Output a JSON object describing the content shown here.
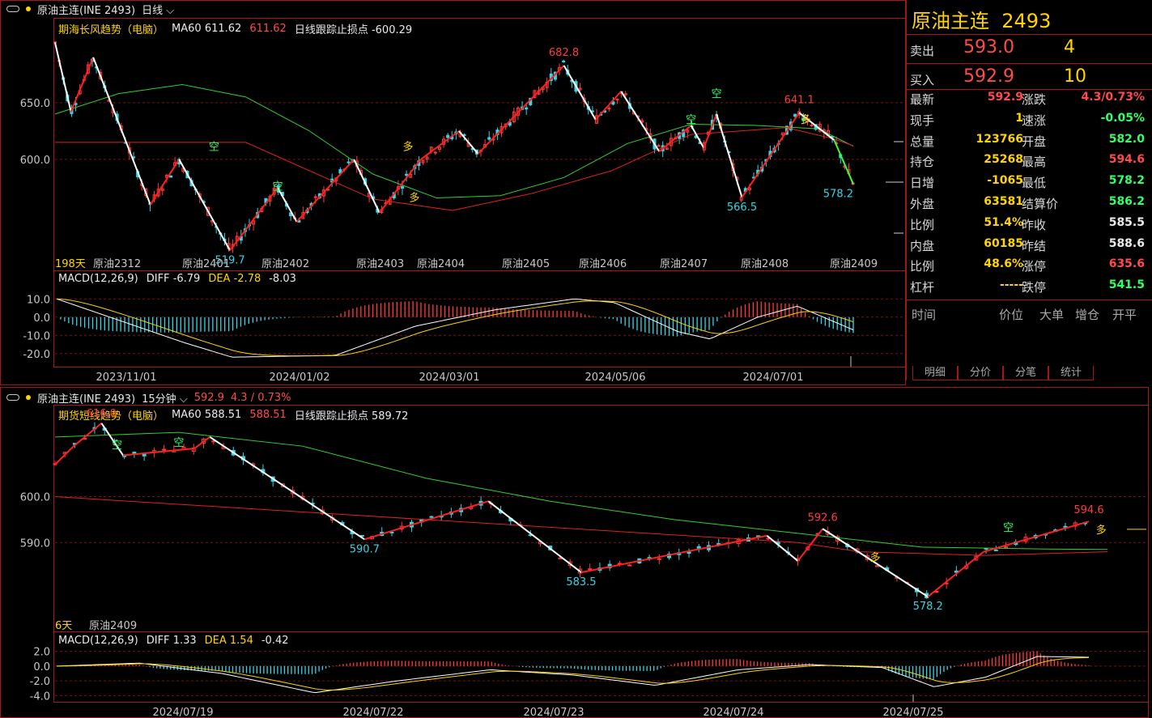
{
  "top_header": {
    "name": "原油主连(INE 2493)",
    "period": "日线"
  },
  "bottom_header": {
    "name": "原油主连(INE 2493)",
    "period": "15分钟",
    "price": "592.9",
    "change": "4.3 / 0.73%"
  },
  "top_legend": {
    "indicator": "期海长风趋势（电脑）",
    "ma_label": "MA60",
    "ma_value": "611.62",
    "ma_value2": "611.62",
    "stop_label": "日线跟踪止损点",
    "stop_value": "-600.29"
  },
  "bottom_legend": {
    "indicator": "期货短线趋势（电脑）",
    "ma_label": "MA60",
    "ma_value": "588.51",
    "ma_value2": "588.51",
    "stop_label": "日线跟踪止损点",
    "stop_value": "589.72"
  },
  "top_macd": {
    "label": "MACD(12,26,9)",
    "diff_label": "DIFF",
    "diff": "-6.79",
    "dea_label": "DEA",
    "dea": "-2.78",
    "macd": "-8.03"
  },
  "bottom_macd": {
    "label": "MACD(12,26,9)",
    "diff_label": "DIFF",
    "diff": "1.33",
    "dea_label": "DEA",
    "dea": "1.54",
    "macd": "-0.42"
  },
  "top_days": "198天",
  "bottom_days": "6天",
  "top_contracts": [
    "原油2312",
    "原油2401",
    "原油2402",
    "原油2403",
    "原油2404",
    "原油2405",
    "原油2406",
    "原油2407",
    "原油2408",
    "原油2409"
  ],
  "bottom_contracts": [
    "原油2409"
  ],
  "top_axis": [
    "650.0",
    "600.0"
  ],
  "top_macd_axis": [
    "10.0",
    "0.0",
    "-10.0",
    "-20.0"
  ],
  "bottom_axis": [
    "600.0",
    "590.0"
  ],
  "bottom_macd_axis": [
    "2.0",
    "0.0",
    "-2.0",
    "-4.0"
  ],
  "top_dates": [
    "2023/11/01",
    "2024/01/02",
    "2024/03/01",
    "2024/05/06",
    "2024/07/01"
  ],
  "bottom_dates": [
    "2024/07/19",
    "2024/07/22",
    "2024/07/23",
    "2024/07/24",
    "2024/07/25"
  ],
  "top_annotations": {
    "high1": "682.8",
    "low1": "519.7",
    "high2": "641.1",
    "low2": "566.5",
    "last": "578.2",
    "kong": "空",
    "duo": "多"
  },
  "bottom_annotations": {
    "high1": "616.0",
    "low1": "590.7",
    "low2": "583.5",
    "high2": "592.6",
    "low3": "578.2",
    "high3": "594.6",
    "kong": "空",
    "duo": "多"
  },
  "quote": {
    "title": "原油主连",
    "code": "2493",
    "sell_label": "卖出",
    "sell_price": "593.0",
    "sell_vol": "4",
    "buy_label": "买入",
    "buy_price": "592.9",
    "buy_vol": "10",
    "left": [
      {
        "k": "最新",
        "v": "592.9",
        "c": "red"
      },
      {
        "k": "现手",
        "v": "1",
        "c": "yel"
      },
      {
        "k": "总量",
        "v": "123766",
        "c": "yel"
      },
      {
        "k": "持仓",
        "v": "25268",
        "c": "yel"
      },
      {
        "k": "日增",
        "v": "-1065",
        "c": "yel"
      },
      {
        "k": "外盘",
        "v": "63581",
        "c": "yel"
      },
      {
        "k": "比例",
        "v": "51.4%",
        "c": "yel"
      },
      {
        "k": "内盘",
        "v": "60185",
        "c": "yel"
      },
      {
        "k": "比例",
        "v": "48.6%",
        "c": "yel"
      },
      {
        "k": "杠杆",
        "v": "-----",
        "c": "yel"
      }
    ],
    "right": [
      {
        "k": "涨跌",
        "v": "4.3/0.73%",
        "c": "red"
      },
      {
        "k": "速涨",
        "v": "-0.05%",
        "c": "grn"
      },
      {
        "k": "开盘",
        "v": "582.0",
        "c": "grn"
      },
      {
        "k": "最高",
        "v": "594.6",
        "c": "red"
      },
      {
        "k": "最低",
        "v": "578.2",
        "c": "grn"
      },
      {
        "k": "结算价",
        "v": "586.2",
        "c": "grn"
      },
      {
        "k": "昨收",
        "v": "585.5",
        "c": "wht"
      },
      {
        "k": "昨结",
        "v": "588.6",
        "c": "wht"
      },
      {
        "k": "涨停",
        "v": "635.6",
        "c": "red"
      },
      {
        "k": "跌停",
        "v": "541.5",
        "c": "grn"
      }
    ],
    "tick_headers": [
      "时间",
      "价位",
      "大单",
      "增仓",
      "开平"
    ],
    "tabs": [
      "明细",
      "分价",
      "分笔",
      "统计"
    ]
  },
  "colors": {
    "up": "#ff3b3b",
    "down": "#33d6e6",
    "ma": "#2fd02f",
    "trend_down": "#ffffff",
    "trend_up": "#ff2020",
    "grid": "#7a1010"
  },
  "chart_data": [
    {
      "type": "candlestick",
      "title": "原油主连(INE 2493) 日线",
      "ylim": [
        505,
        712
      ],
      "ticks": [
        650.0,
        600.0
      ],
      "trend_points": [
        [
          0,
          703
        ],
        [
          5,
          642
        ],
        [
          12,
          690
        ],
        [
          30,
          560
        ],
        [
          39,
          600
        ],
        [
          55,
          519.7
        ],
        [
          70,
          575
        ],
        [
          76,
          545
        ],
        [
          94,
          600
        ],
        [
          102,
          553
        ],
        [
          115,
          600
        ],
        [
          127,
          625
        ],
        [
          133,
          605
        ],
        [
          160,
          682.8
        ],
        [
          170,
          635
        ],
        [
          178,
          660
        ],
        [
          190,
          607
        ],
        [
          200,
          630
        ],
        [
          204,
          610
        ],
        [
          208,
          640
        ],
        [
          216,
          566.5
        ],
        [
          234,
          641.1
        ],
        [
          245,
          617
        ],
        [
          251,
          578.2
        ]
      ],
      "ma60": [
        [
          0,
          640
        ],
        [
          20,
          658
        ],
        [
          40,
          666
        ],
        [
          60,
          655
        ],
        [
          80,
          625
        ],
        [
          100,
          587
        ],
        [
          120,
          566
        ],
        [
          140,
          568
        ],
        [
          160,
          584
        ],
        [
          180,
          614
        ],
        [
          200,
          631
        ],
        [
          220,
          630
        ],
        [
          240,
          627
        ],
        [
          251,
          611.62
        ]
      ]
    },
    {
      "type": "candlestick",
      "title": "原油主连(INE 2493) 15分钟",
      "ylim": [
        571,
        616.5
      ],
      "ticks": [
        600.0,
        590.0
      ],
      "trend_points": [
        [
          0,
          607
        ],
        [
          6,
          611
        ],
        [
          15,
          616.0
        ],
        [
          22,
          609
        ],
        [
          45,
          610.5
        ],
        [
          50,
          613
        ],
        [
          100,
          590.7
        ],
        [
          140,
          599
        ],
        [
          170,
          583.5
        ],
        [
          230,
          591.5
        ],
        [
          240,
          586
        ],
        [
          248,
          593
        ],
        [
          282,
          578.2
        ],
        [
          300,
          588
        ],
        [
          334,
          594.6
        ]
      ],
      "ma60": [
        [
          0,
          613
        ],
        [
          40,
          614
        ],
        [
          80,
          611
        ],
        [
          120,
          604
        ],
        [
          160,
          599
        ],
        [
          200,
          595
        ],
        [
          240,
          592
        ],
        [
          280,
          589
        ],
        [
          320,
          588.6
        ],
        [
          340,
          588.51
        ]
      ]
    }
  ]
}
